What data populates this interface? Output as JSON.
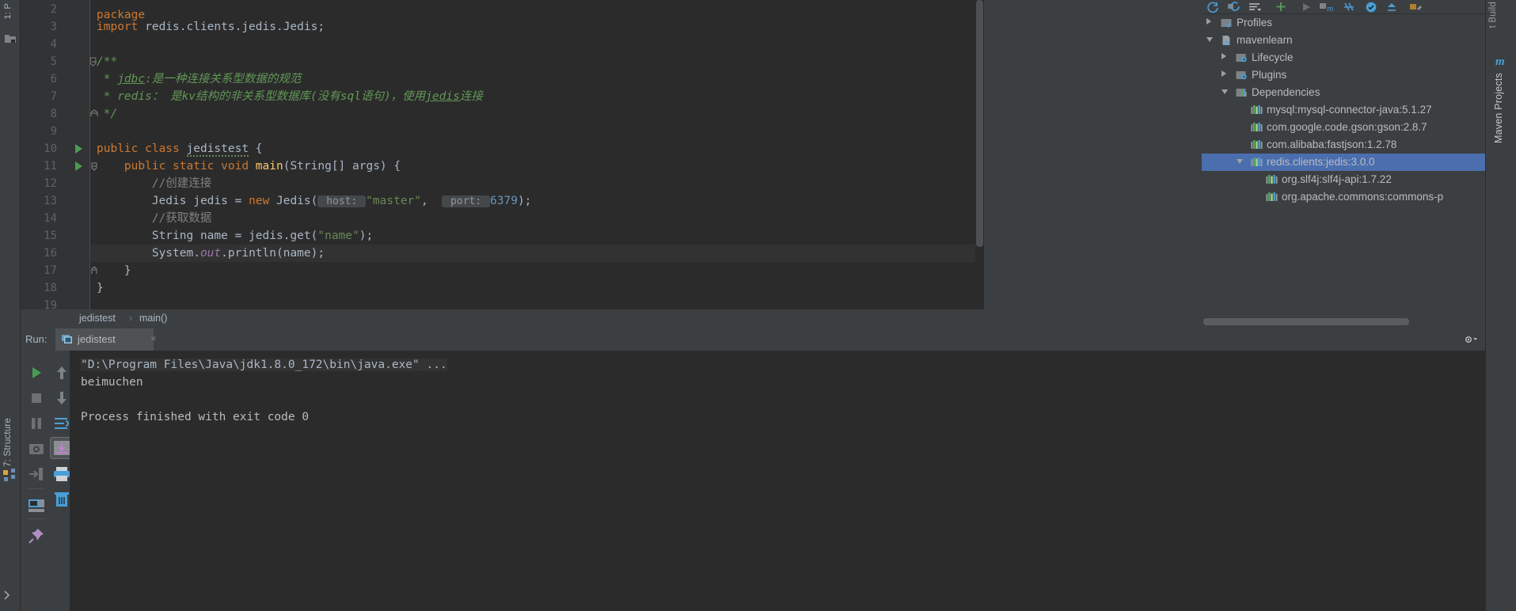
{
  "editor": {
    "lines": [
      {
        "n": "2",
        "segments": []
      },
      {
        "n": "3",
        "segments": [
          {
            "t": "import ",
            "c": "kw"
          },
          {
            "t": "redis.clients.jedis.Jedis;",
            "c": ""
          }
        ]
      },
      {
        "n": "4",
        "segments": []
      },
      {
        "n": "5",
        "segments": [
          {
            "t": "/**",
            "c": "doc"
          }
        ]
      },
      {
        "n": "6",
        "segments": [
          {
            "t": " * ",
            "c": "doc"
          },
          {
            "t": "jdbc",
            "c": "docb"
          },
          {
            "t": ":是一种连接关系型数据的规范",
            "c": "doc"
          }
        ]
      },
      {
        "n": "7",
        "segments": [
          {
            "t": " * redis： 是kv结构的非关系型数据库(没有sql语句)，使用",
            "c": "doc"
          },
          {
            "t": "jedis",
            "c": "docb"
          },
          {
            "t": "连接",
            "c": "doc"
          }
        ]
      },
      {
        "n": "8",
        "segments": [
          {
            "t": " */",
            "c": "doc"
          }
        ]
      },
      {
        "n": "9",
        "segments": []
      },
      {
        "n": "10",
        "segments": [
          {
            "t": "public class ",
            "c": "kw"
          },
          {
            "t": "jedistest",
            "c": "warnunder"
          },
          {
            "t": " {",
            "c": ""
          }
        ]
      },
      {
        "n": "11",
        "segments": [
          {
            "t": "    ",
            "c": ""
          },
          {
            "t": "public static void ",
            "c": "kw"
          },
          {
            "t": "main",
            "c": "fn"
          },
          {
            "t": "(String[] args) {",
            "c": ""
          }
        ]
      },
      {
        "n": "12",
        "segments": [
          {
            "t": "        //创建连接",
            "c": "cmt"
          }
        ]
      },
      {
        "n": "13",
        "segments": [
          {
            "t": "        Jedis jedis = ",
            "c": ""
          },
          {
            "t": "new ",
            "c": "kw"
          },
          {
            "t": "Jedis(",
            "c": ""
          },
          {
            "t": " host: ",
            "c": "hint"
          },
          {
            "t": "\"master\"",
            "c": "str"
          },
          {
            "t": ",  ",
            "c": ""
          },
          {
            "t": " port: ",
            "c": "hint"
          },
          {
            "t": "6379",
            "c": "num"
          },
          {
            "t": ");",
            "c": ""
          }
        ]
      },
      {
        "n": "14",
        "segments": [
          {
            "t": "        //获取数据",
            "c": "cmt"
          }
        ]
      },
      {
        "n": "15",
        "segments": [
          {
            "t": "        String name = jedis.get(",
            "c": ""
          },
          {
            "t": "\"name\"",
            "c": "str"
          },
          {
            "t": ");",
            "c": ""
          }
        ]
      },
      {
        "n": "16",
        "segments": [
          {
            "t": "        System.",
            "c": ""
          },
          {
            "t": "out",
            "c": "fld"
          },
          {
            "t": ".println(name);",
            "c": ""
          }
        ]
      },
      {
        "n": "17",
        "segments": [
          {
            "t": "    }",
            "c": ""
          }
        ]
      },
      {
        "n": "18",
        "segments": [
          {
            "t": "}",
            "c": ""
          }
        ]
      },
      {
        "n": "19",
        "segments": []
      }
    ],
    "current_line_index": 14,
    "run_marker_lines": [
      8,
      9
    ]
  },
  "breadcrumb": {
    "class": "jedistest",
    "separator": "›",
    "method": "main()"
  },
  "run_panel": {
    "label": "Run:",
    "tab_name": "jedistest",
    "tab_close": "×",
    "tab_icon": "run-configuration-icon",
    "toolbar_icons": [
      "rerun-icon",
      "stop-icon",
      "pause-icon",
      "camera-icon",
      "exit-icon",
      "console-icon",
      "pin-icon"
    ],
    "toolbar_icons_right": [
      "scroll-up-icon",
      "scroll-down-icon",
      "soft-wrap-icon",
      "scroll-to-end-icon",
      "print-icon",
      "trash-icon"
    ],
    "header_icons": [
      "settings-gear-icon",
      "export-icon"
    ],
    "console_lines": [
      {
        "text": "\"D:\\Program Files\\Java\\jdk1.8.0_172\\bin\\java.exe\" ...",
        "style": "cmdline"
      },
      {
        "text": "beimuchen",
        "style": "plain"
      },
      {
        "text": "",
        "style": "plain"
      },
      {
        "text": "Process finished with exit code 0",
        "style": "plain"
      }
    ]
  },
  "maven": {
    "panel_title": "Maven Projects",
    "toolbar_icons": [
      "refresh-icon",
      "reimport-icon",
      "list-icon",
      "add-icon",
      "run-icon",
      "maven-module-icon",
      "skip-tests-icon",
      "toggle-offline-icon",
      "collapse-icon",
      "maven-settings-icon"
    ],
    "tree": [
      {
        "label": "Profiles",
        "icon": "folder-profiles-icon",
        "indent": 0,
        "twisty": "right",
        "selected": false
      },
      {
        "label": "mavenlearn",
        "icon": "maven-project-icon",
        "indent": 0,
        "twisty": "down",
        "selected": false
      },
      {
        "label": "Lifecycle",
        "icon": "folder-gear-icon",
        "indent": 1,
        "twisty": "right",
        "selected": false
      },
      {
        "label": "Plugins",
        "icon": "folder-gear-icon",
        "indent": 1,
        "twisty": "right",
        "selected": false
      },
      {
        "label": "Dependencies",
        "icon": "folder-deps-icon",
        "indent": 1,
        "twisty": "down",
        "selected": false
      },
      {
        "label": "mysql:mysql-connector-java:5.1.27",
        "icon": "dependency-icon",
        "indent": 2,
        "twisty": "none",
        "selected": false
      },
      {
        "label": "com.google.code.gson:gson:2.8.7",
        "icon": "dependency-icon",
        "indent": 2,
        "twisty": "none",
        "selected": false
      },
      {
        "label": "com.alibaba:fastjson:1.2.78",
        "icon": "dependency-icon",
        "indent": 2,
        "twisty": "none",
        "selected": false
      },
      {
        "label": "redis.clients:jedis:3.0.0",
        "icon": "dependency-icon",
        "indent": 2,
        "twisty": "down",
        "selected": true
      },
      {
        "label": "org.slf4j:slf4j-api:1.7.22",
        "icon": "dependency-icon",
        "indent": 3,
        "twisty": "none",
        "selected": false
      },
      {
        "label": "org.apache.commons:commons-p",
        "icon": "dependency-icon",
        "indent": 3,
        "twisty": "none",
        "selected": false
      }
    ]
  },
  "left_strip": {
    "project_label": "1: P",
    "structure_label": "7: Structure",
    "icons": [
      "project-icon",
      "structure-icon",
      "favorites-icon"
    ]
  },
  "right_strip": {
    "build_label": "t Build",
    "maven_label": "Maven Projects",
    "maven_glyph": "m"
  },
  "colors": {
    "editor_bg": "#2b2b2b",
    "panel_bg": "#3c3f41",
    "selection_blue": "#4b6eaf",
    "text": "#a9b7c6",
    "keyword": "#cc7832",
    "string": "#6a8759",
    "number": "#6897bb",
    "comment": "#808080",
    "javadoc": "#629755",
    "method": "#ffc66d",
    "field": "#9876aa",
    "accent_blue": "#4a9fd8",
    "run_green": "#499c54"
  }
}
